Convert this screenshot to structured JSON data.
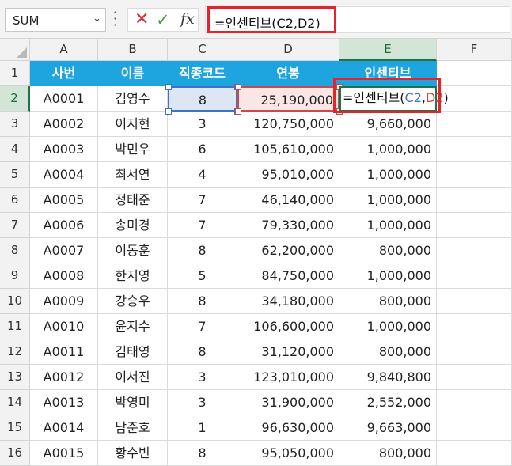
{
  "formula_bar": {
    "name_box": "SUM",
    "formula": "=인센티브(C2,D2)",
    "cancel_icon": "close-icon",
    "enter_icon": "check-icon",
    "fx_label": "fx"
  },
  "columns": [
    "A",
    "B",
    "C",
    "D",
    "E",
    "F"
  ],
  "headers": [
    "사번",
    "이름",
    "직종코드",
    "연봉",
    "인센티브"
  ],
  "edit_cell": {
    "prefix": "=인센티브(",
    "ref1": "C2",
    "comma": ",",
    "ref2": "D2",
    "suffix": ")"
  },
  "rows": [
    {
      "num": "1"
    },
    {
      "num": "2",
      "a": "A0001",
      "b": "김영수",
      "c": "8",
      "d": "25,190,000",
      "e": ""
    },
    {
      "num": "3",
      "a": "A0002",
      "b": "이지현",
      "c": "3",
      "d": "120,750,000",
      "e": "9,660,000"
    },
    {
      "num": "4",
      "a": "A0003",
      "b": "박민우",
      "c": "6",
      "d": "105,610,000",
      "e": "1,000,000"
    },
    {
      "num": "5",
      "a": "A0004",
      "b": "최서연",
      "c": "4",
      "d": "95,010,000",
      "e": "1,000,000"
    },
    {
      "num": "6",
      "a": "A0005",
      "b": "정태준",
      "c": "7",
      "d": "46,140,000",
      "e": "1,000,000"
    },
    {
      "num": "7",
      "a": "A0006",
      "b": "송미경",
      "c": "7",
      "d": "79,330,000",
      "e": "1,000,000"
    },
    {
      "num": "8",
      "a": "A0007",
      "b": "이동훈",
      "c": "8",
      "d": "62,200,000",
      "e": "800,000"
    },
    {
      "num": "9",
      "a": "A0008",
      "b": "한지영",
      "c": "5",
      "d": "84,750,000",
      "e": "1,000,000"
    },
    {
      "num": "10",
      "a": "A0009",
      "b": "강승우",
      "c": "8",
      "d": "34,180,000",
      "e": "800,000"
    },
    {
      "num": "11",
      "a": "A0010",
      "b": "윤지수",
      "c": "7",
      "d": "106,600,000",
      "e": "1,000,000"
    },
    {
      "num": "12",
      "a": "A0011",
      "b": "김태영",
      "c": "8",
      "d": "31,120,000",
      "e": "800,000"
    },
    {
      "num": "13",
      "a": "A0012",
      "b": "이서진",
      "c": "3",
      "d": "123,010,000",
      "e": "9,840,800"
    },
    {
      "num": "14",
      "a": "A0013",
      "b": "박영미",
      "c": "3",
      "d": "31,900,000",
      "e": "2,552,000"
    },
    {
      "num": "15",
      "a": "A0014",
      "b": "남준호",
      "c": "1",
      "d": "96,630,000",
      "e": "9,663,000"
    },
    {
      "num": "16",
      "a": "A0015",
      "b": "황수빈",
      "c": "8",
      "d": "95,050,000",
      "e": "800,000"
    }
  ]
}
